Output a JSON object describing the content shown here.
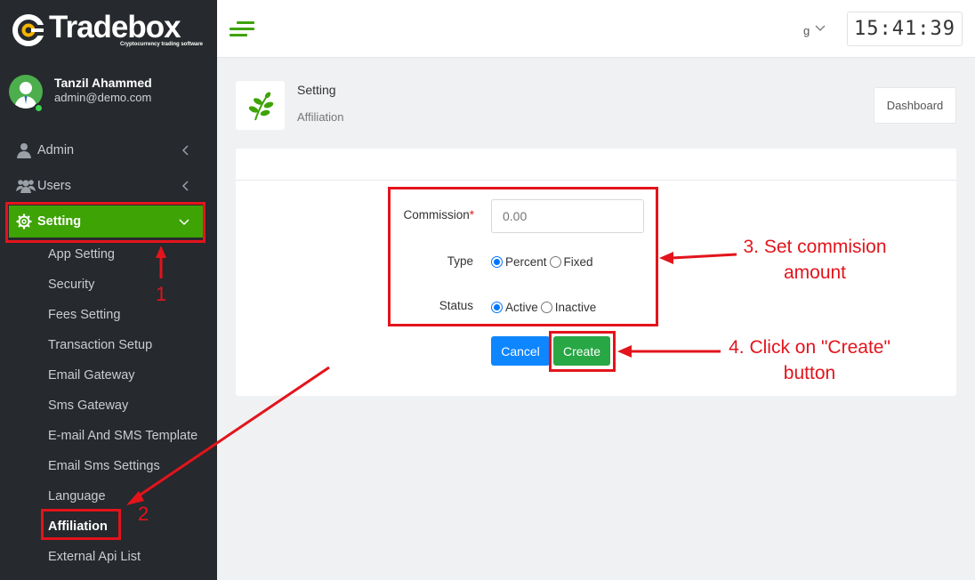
{
  "brand": {
    "part1": "Trade",
    "part2": "box",
    "tagline": "Cryptocurrency trading software"
  },
  "user": {
    "name": "Tanzil Ahammed",
    "email": "admin@demo.com"
  },
  "nav": {
    "admin": "Admin",
    "users": "Users",
    "setting": "Setting",
    "sub": [
      "App Setting",
      "Security",
      "Fees Setting",
      "Transaction Setup",
      "Email Gateway",
      "Sms Gateway",
      "E-mail And SMS Template",
      "Email Sms Settings",
      "Language",
      "Affiliation",
      "External Api List"
    ]
  },
  "topbar": {
    "lang": "g",
    "clock": "15:41:39"
  },
  "page": {
    "title": "Setting",
    "subtitle": "Affiliation",
    "dashboard_button": "Dashboard"
  },
  "form": {
    "commission_label": "Commission",
    "required_mark": "*",
    "commission_placeholder": "0.00",
    "type_label": "Type",
    "type_options": [
      "Percent",
      "Fixed"
    ],
    "type_selected": "Percent",
    "status_label": "Status",
    "status_options": [
      "Active",
      "Inactive"
    ],
    "status_selected": "Active",
    "cancel_label": "Cancel",
    "create_label": "Create"
  },
  "annotations": {
    "step1": "1",
    "step2": "2",
    "step3_line1": "3. Set commision",
    "step3_line2": "amount",
    "step4_line1": "4. Click on \"Create\"",
    "step4_line2": "button"
  },
  "colors": {
    "sidebar": "#26292d",
    "accent_green": "#3ea304",
    "annotation_red": "#e3141c",
    "primary_blue": "#0d86ff",
    "success_green": "#28a745"
  }
}
